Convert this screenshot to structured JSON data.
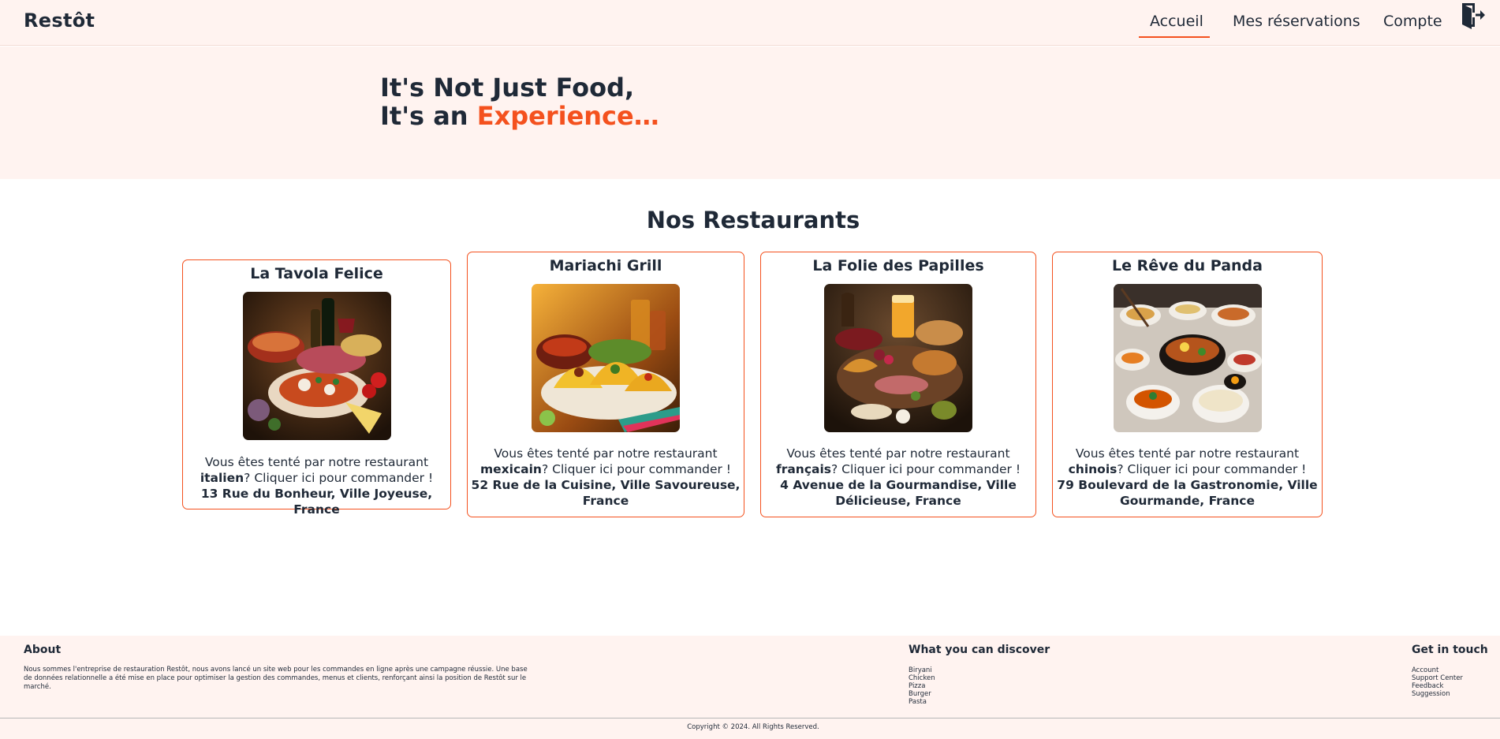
{
  "nav": {
    "brand": "Restôt",
    "links": [
      "Accueil",
      "Mes réservations",
      "Compte"
    ],
    "active": "Accueil",
    "logout_icon": "logout-door-icon"
  },
  "hero": {
    "line1": "It's Not Just Food,",
    "line2_prefix": "It's an ",
    "line2_accent": "Experience…"
  },
  "section": {
    "title": "Nos Restaurants"
  },
  "restaurants": [
    {
      "name": "La Tavola Felice",
      "intro": "Vous êtes tenté par notre restaurant",
      "cuisine": "italien",
      "cta": "? Cliquer ici pour commander !",
      "address": "13 Rue du Bonheur, Ville Joyeuse, France"
    },
    {
      "name": "Mariachi Grill",
      "intro": "Vous êtes tenté par notre restaurant",
      "cuisine": "mexicain",
      "cta": "? Cliquer ici pour commander !",
      "address": "52 Rue de la Cuisine, Ville Savoureuse, France"
    },
    {
      "name": "La Folie des Papilles",
      "intro": "Vous êtes tenté par notre restaurant",
      "cuisine": "français",
      "cta": "? Cliquer ici pour commander !",
      "address": "4 Avenue de la Gourmandise, Ville Délicieuse, France"
    },
    {
      "name": "Le Rêve du Panda",
      "intro": "Vous êtes tenté par notre restaurant",
      "cuisine": "chinois",
      "cta": "? Cliquer ici pour commander !",
      "address": "79 Boulevard de la Gastronomie, Ville Gourmande, France"
    }
  ],
  "footer": {
    "about_title": "About",
    "about_text": "Nous sommes l'entreprise de restauration Restôt, nous avons lancé un site web pour les commandes en ligne après une campagne réussie. Une base de données relationnelle a été mise en place pour optimiser la gestion des commandes, menus et clients, renforçant ainsi la position de Restôt sur le marché.",
    "discover_title": "What you can discover",
    "discover_items": [
      "Biryani",
      "Chicken",
      "Pizza",
      "Burger",
      "Pasta"
    ],
    "contact_title": "Get in touch",
    "contact_items": [
      "Account",
      "Support Center",
      "Feedback",
      "Suggession"
    ],
    "copyright": "Copyright © 2024. All Rights Reserved."
  },
  "colors": {
    "accent": "#f4511e",
    "background_tint": "#fff3f0",
    "text": "#1f2937"
  }
}
